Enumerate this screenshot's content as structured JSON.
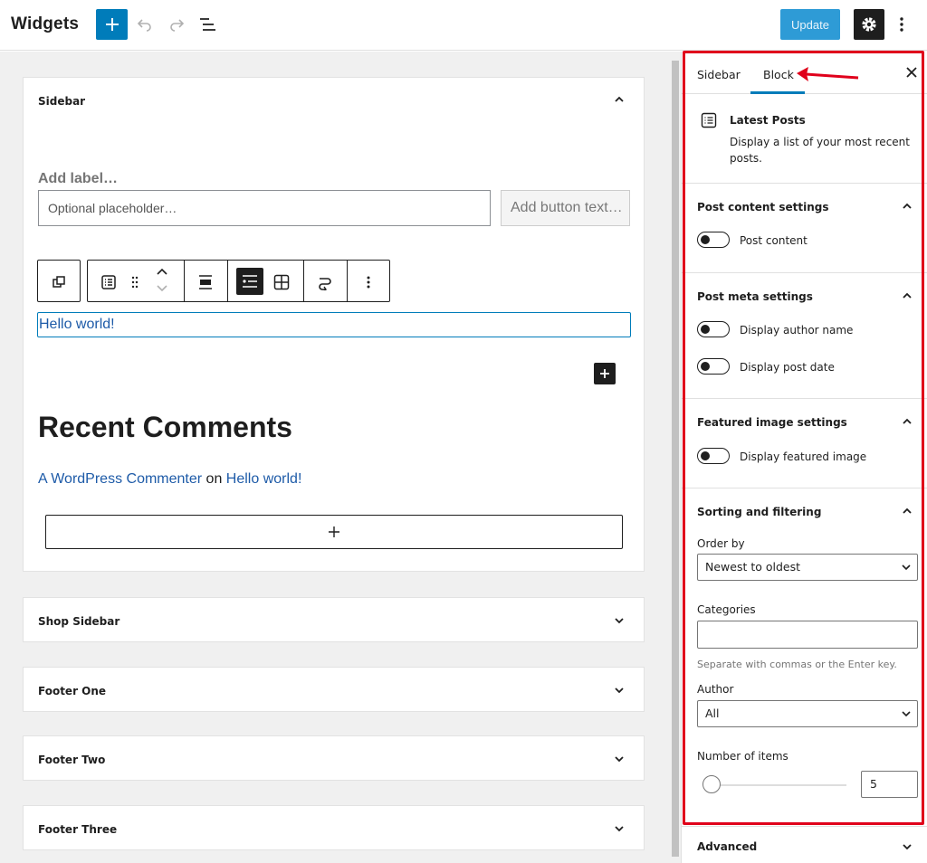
{
  "header": {
    "title": "Widgets",
    "update_label": "Update",
    "icons": [
      "plus-icon",
      "undo-icon",
      "redo-icon",
      "list-view-icon",
      "gear-icon",
      "more-vertical-icon"
    ],
    "accent": "#007cba"
  },
  "canvas": {
    "areas": [
      {
        "title": "Sidebar",
        "expanded": true
      },
      {
        "title": "Shop Sidebar",
        "expanded": false
      },
      {
        "title": "Footer One",
        "expanded": false
      },
      {
        "title": "Footer Two",
        "expanded": false
      },
      {
        "title": "Footer Three",
        "expanded": false
      }
    ],
    "search": {
      "label": "Add label…",
      "placeholder": "Optional placeholder…",
      "button": "Add button text…"
    },
    "latest_posts": {
      "items": [
        "Hello world!"
      ]
    },
    "recent_comments": {
      "heading": "Recent Comments",
      "author": "A WordPress Commenter",
      "connector": "on",
      "post": "Hello world!"
    }
  },
  "panel": {
    "tabs": [
      {
        "label": "Sidebar",
        "active": false
      },
      {
        "label": "Block",
        "active": true
      }
    ],
    "block_card": {
      "title": "Latest Posts",
      "description": "Display a list of your most recent posts."
    },
    "post_content": {
      "title": "Post content settings",
      "toggles": [
        {
          "label": "Post content",
          "on": false
        }
      ]
    },
    "post_meta": {
      "title": "Post meta settings",
      "toggles": [
        {
          "label": "Display author name",
          "on": false
        },
        {
          "label": "Display post date",
          "on": false
        }
      ]
    },
    "featured_image": {
      "title": "Featured image settings",
      "toggles": [
        {
          "label": "Display featured image",
          "on": false
        }
      ]
    },
    "sorting": {
      "title": "Sorting and filtering",
      "order_by_label": "Order by",
      "order_by_value": "Newest to oldest",
      "categories_label": "Categories",
      "categories_help": "Separate with commas or the Enter key.",
      "author_label": "Author",
      "author_value": "All",
      "number_label": "Number of items",
      "number_value": "5"
    },
    "advanced": {
      "title": "Advanced"
    }
  },
  "annotation": {
    "highlight_color": "#e0001b"
  }
}
